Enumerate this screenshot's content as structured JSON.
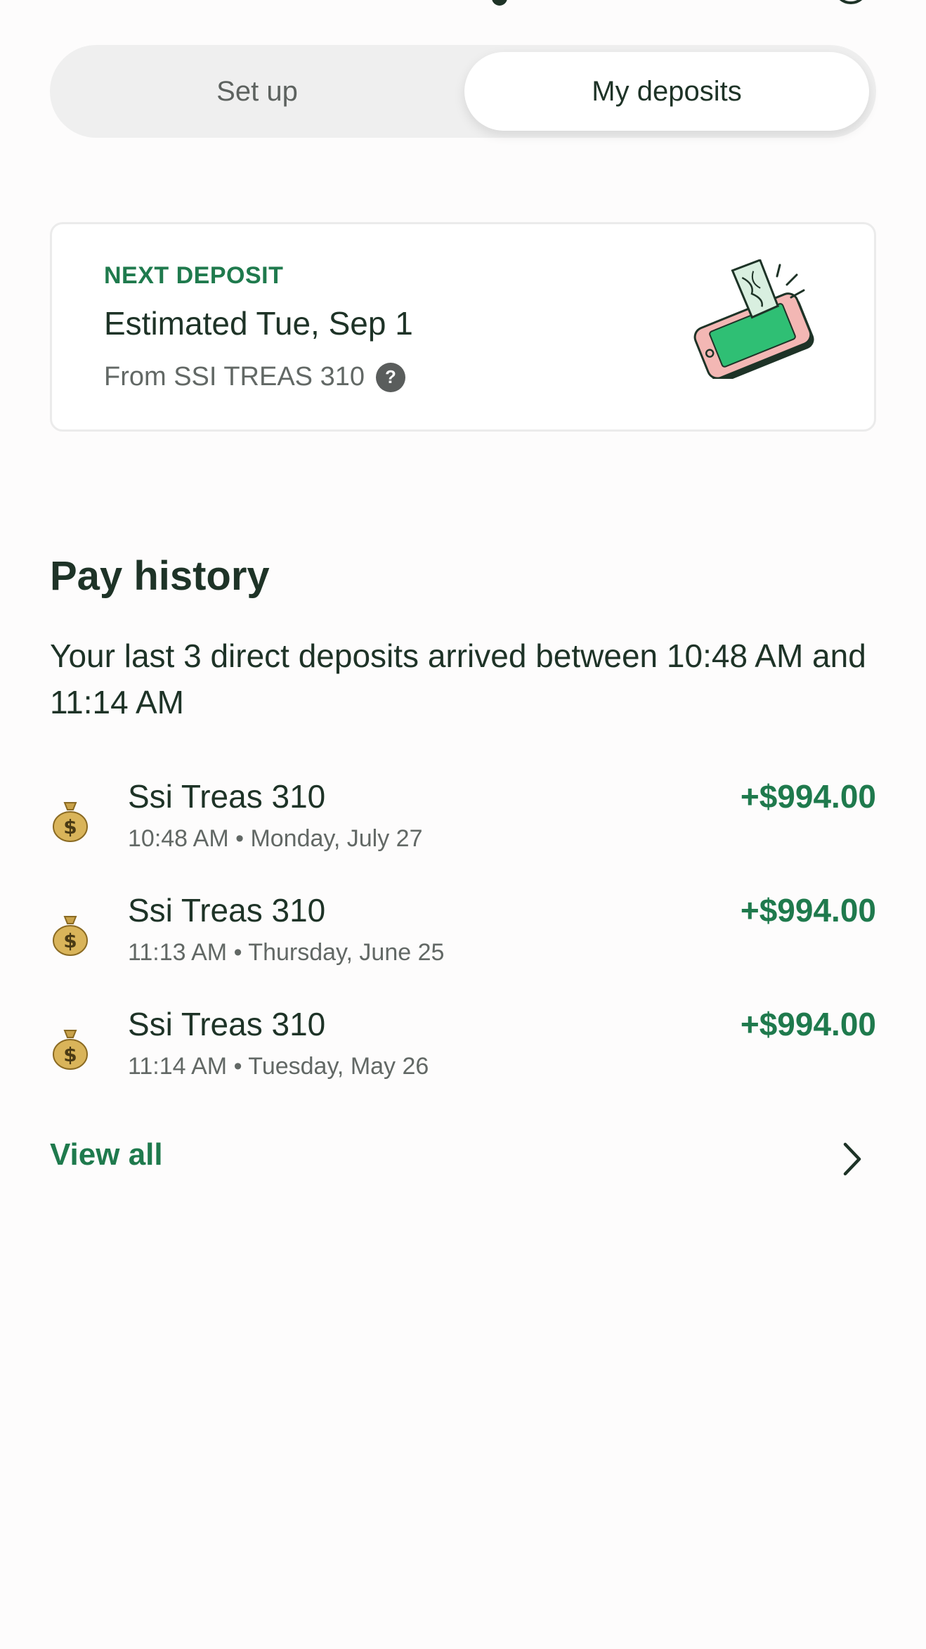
{
  "tabs": {
    "setup_label": "Set up",
    "deposits_label": "My deposits",
    "selected": "My deposits"
  },
  "next_deposit": {
    "eyebrow": "NEXT DEPOSIT",
    "title": "Estimated Tue, Sep 1",
    "source": "From SSI  TREAS 310",
    "help_symbol": "?"
  },
  "pay_history": {
    "title": "Pay history",
    "summary": "Your last 3 direct deposits arrived between 10:48 AM and 11:14 AM",
    "items": [
      {
        "icon": "money-bag-icon",
        "name": "Ssi  Treas 310",
        "meta": "10:48 AM • Monday, July 27",
        "amount": "+$994.00"
      },
      {
        "icon": "money-bag-icon",
        "name": "Ssi  Treas 310",
        "meta": "11:13 AM • Thursday, June 25",
        "amount": "+$994.00"
      },
      {
        "icon": "money-bag-icon",
        "name": "Ssi  Treas 310",
        "meta": "11:14 AM • Tuesday, May 26",
        "amount": "+$994.00"
      }
    ],
    "view_all_label": "View all"
  },
  "colors": {
    "accent_green": "#1f7a4d",
    "text_dark": "#1e3327",
    "text_muted": "#626865"
  }
}
